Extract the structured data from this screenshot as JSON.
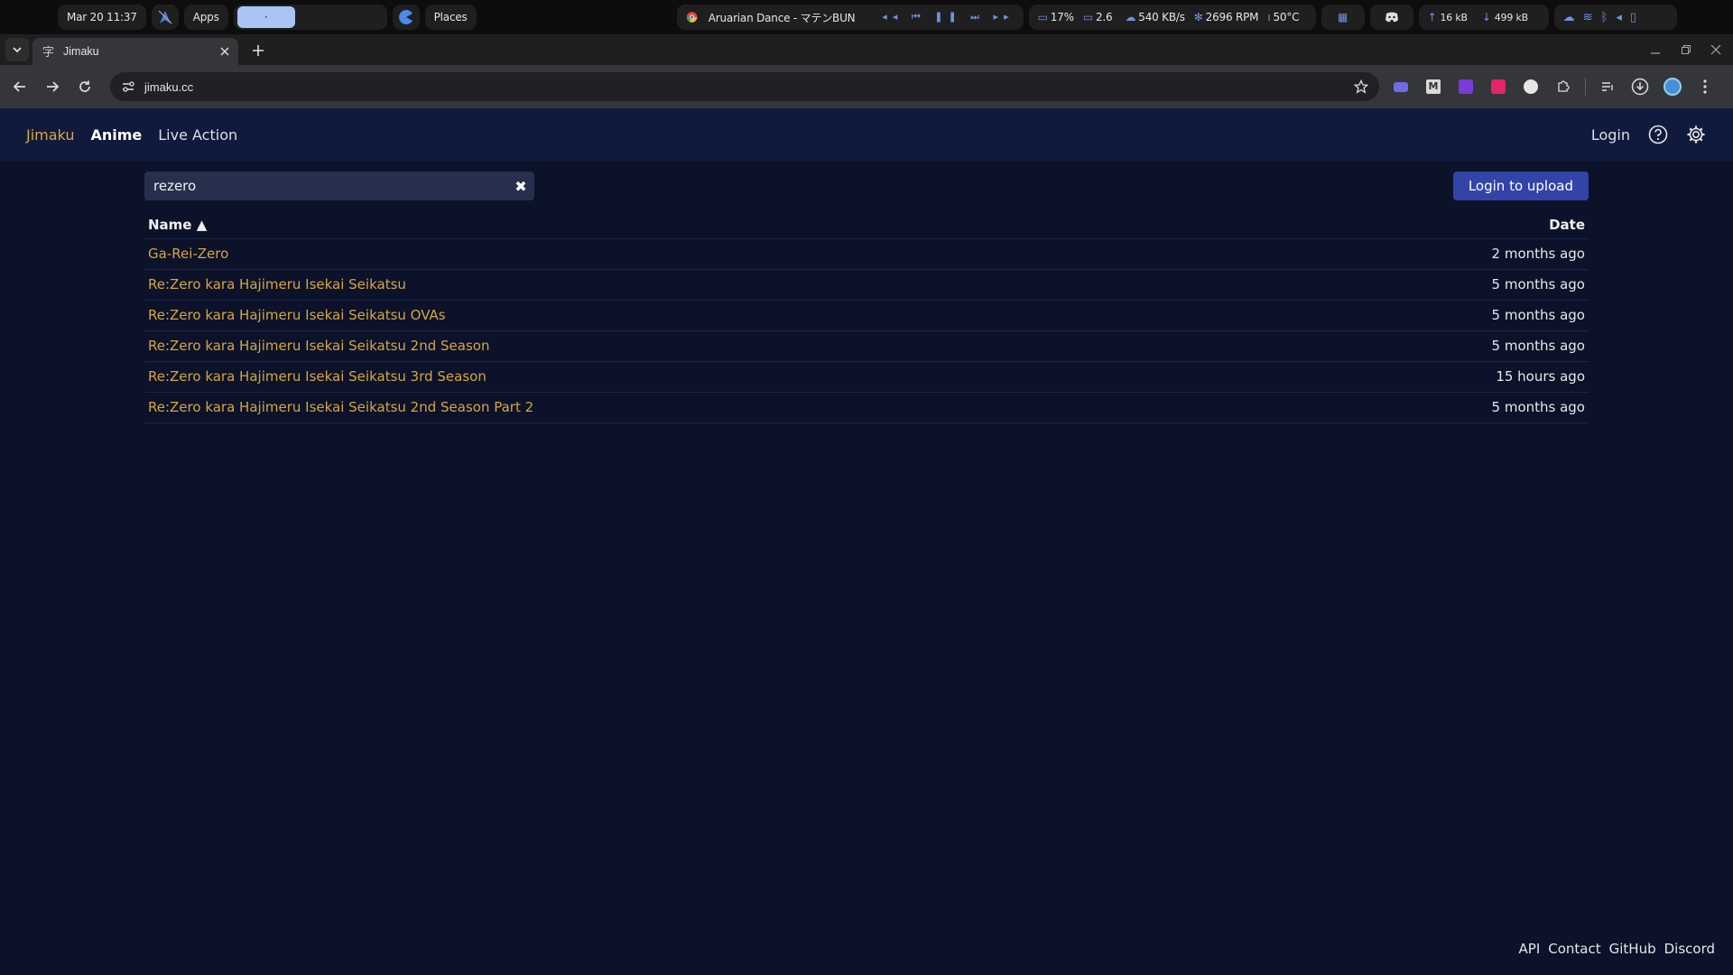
{
  "sysbar": {
    "datetime": "Mar 20  11:37",
    "apps_label": "Apps",
    "workspace_label": "·",
    "places_label": "Places",
    "media_title": "Aruarian Dance - マテンBUN",
    "cpu": "17%",
    "load": "2.6",
    "net_speed": "540 KB/s",
    "fan": "2696 RPM",
    "temp": "50°C",
    "upload": "16 kB",
    "download": "499 kB"
  },
  "browser": {
    "tab_title": "Jimaku",
    "url": "jimaku.cc"
  },
  "site": {
    "brand": "Jimaku",
    "nav": [
      "Anime",
      "Live Action"
    ],
    "login": "Login"
  },
  "search": {
    "value": "rezero"
  },
  "upload_button": "Login to upload",
  "table": {
    "columns": {
      "name": "Name ▲",
      "date": "Date"
    },
    "rows": [
      {
        "name": "Ga-Rei-Zero",
        "date": "2 months ago"
      },
      {
        "name": "Re:Zero kara Hajimeru Isekai Seikatsu",
        "date": "5 months ago"
      },
      {
        "name": "Re:Zero kara Hajimeru Isekai Seikatsu OVAs",
        "date": "5 months ago"
      },
      {
        "name": "Re:Zero kara Hajimeru Isekai Seikatsu 2nd Season",
        "date": "5 months ago"
      },
      {
        "name": "Re:Zero kara Hajimeru Isekai Seikatsu 3rd Season",
        "date": "15 hours ago"
      },
      {
        "name": "Re:Zero kara Hajimeru Isekai Seikatsu 2nd Season Part 2",
        "date": "5 months ago"
      }
    ]
  },
  "footer": [
    "API",
    "Contact",
    "GitHub",
    "Discord"
  ],
  "colors": {
    "accent": "#d7a63e",
    "button": "#3244a8",
    "bg": "#0b1229",
    "nav_bg": "#101a3c"
  }
}
